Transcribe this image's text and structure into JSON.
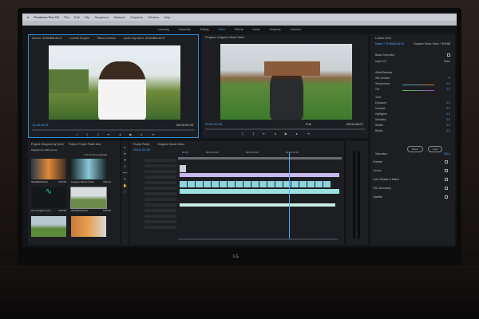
{
  "app": {
    "name": "Premiere Pro CC",
    "menu": [
      "File",
      "Edit",
      "Clip",
      "Sequence",
      "Markers",
      "Graphics",
      "Window",
      "Help"
    ]
  },
  "workspaces": [
    "Learning",
    "Assembly",
    "Editing",
    "Color",
    "Effects",
    "Audio",
    "Graphics",
    "Libraries"
  ],
  "active_workspace": "Color",
  "source": {
    "tabs": [
      "Source: SHANBAL6ICH",
      "Lumetri Scopes",
      "Effect Controls",
      "Audio Clip Mixer: SHANBAL6ICH"
    ],
    "timecode_in": "14:26:45:11",
    "timecode_out": "00:02:01:00"
  },
  "program": {
    "tab": "Program: Kingdom Music Video",
    "timecode_in": "00:01:22:06",
    "zoom": "Full",
    "timecode_out": "00:02:48:07"
  },
  "lumetri": {
    "title": "Lumetri Color",
    "clip": "Master * SHANBAL6ICH",
    "sequence": "Kingdom Music Video * SHANBAL6ICH",
    "basic": "Basic Correction",
    "input_lut_label": "Input LUT",
    "input_lut": "None",
    "white_balance": "White Balance",
    "wb_selector": "WB Selector",
    "wb_rows": [
      {
        "label": "Temperature",
        "value": "0.0"
      },
      {
        "label": "Tint",
        "value": "0.0"
      }
    ],
    "tone": "Tone",
    "tone_rows": [
      {
        "label": "Exposure",
        "value": "0.0"
      },
      {
        "label": "Contrast",
        "value": "0.0"
      },
      {
        "label": "Highlights",
        "value": "0.0"
      },
      {
        "label": "Shadows",
        "value": "0.0"
      },
      {
        "label": "Whites",
        "value": "0.0"
      },
      {
        "label": "Blacks",
        "value": "0.0"
      }
    ],
    "reset": "Reset",
    "auto": "Auto",
    "saturation": "Saturation",
    "saturation_value": "100.0",
    "sections": [
      "Creative",
      "Curves",
      "Color Wheels & Match",
      "HSL Secondary",
      "Vignette"
    ]
  },
  "project": {
    "tabs": [
      "Project: Kingdom by Nehri",
      "Project: Purple Pickle Music Vid"
    ],
    "path": "Kingdom by Nehri.prproj",
    "selection": "1 of 14 items selected",
    "items": [
      {
        "name": "SHANBAL6ICH",
        "dur": "0:30:05"
      },
      {
        "name": "Kingdom Music Video",
        "dur": "3:01:21"
      },
      {
        "name": "01.1 Kingdom (Ou...",
        "dur": "3:00:00"
      },
      {
        "name": "SHANBAL6ICH",
        "dur": "0:30:05"
      }
    ]
  },
  "timeline": {
    "tabs": [
      "Purple Pickle",
      "Kingdom Music Video"
    ],
    "timecode": "00:01:22:00",
    "ruler": [
      "00:00",
      "00:01:04:00",
      "00:02:08:00",
      "00:03:12:00"
    ]
  },
  "brand": "LG"
}
